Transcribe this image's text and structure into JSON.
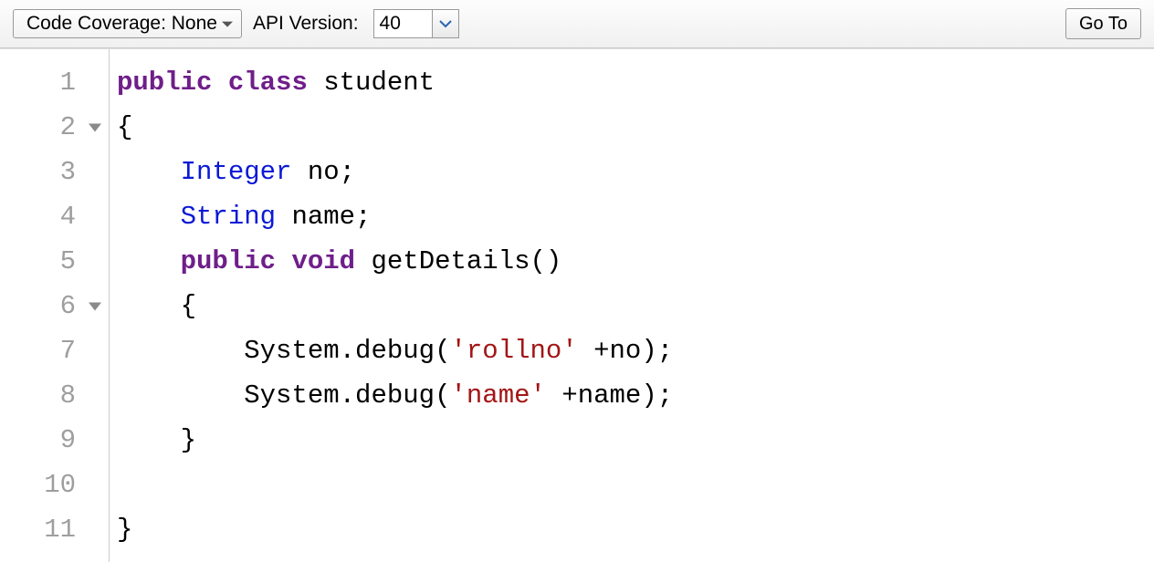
{
  "toolbar": {
    "code_coverage_label": "Code Coverage: None",
    "api_version_label": "API Version:",
    "api_version_value": "40",
    "goto_label": "Go To"
  },
  "editor": {
    "lines": [
      {
        "num": "1",
        "fold": false,
        "tokens": [
          [
            "kw",
            "public"
          ],
          [
            "plain",
            " "
          ],
          [
            "kw",
            "class"
          ],
          [
            "plain",
            " "
          ],
          [
            "ident",
            "student"
          ]
        ]
      },
      {
        "num": "2",
        "fold": true,
        "tokens": [
          [
            "punct",
            "{"
          ]
        ]
      },
      {
        "num": "3",
        "fold": false,
        "tokens": [
          [
            "plain",
            "    "
          ],
          [
            "type",
            "Integer"
          ],
          [
            "plain",
            " "
          ],
          [
            "ident",
            "no"
          ],
          [
            "punct",
            ";"
          ]
        ]
      },
      {
        "num": "4",
        "fold": false,
        "tokens": [
          [
            "plain",
            "    "
          ],
          [
            "type",
            "String"
          ],
          [
            "plain",
            " "
          ],
          [
            "ident",
            "name"
          ],
          [
            "punct",
            ";"
          ]
        ]
      },
      {
        "num": "5",
        "fold": false,
        "tokens": [
          [
            "plain",
            "    "
          ],
          [
            "kw",
            "public"
          ],
          [
            "plain",
            " "
          ],
          [
            "kw",
            "void"
          ],
          [
            "plain",
            " "
          ],
          [
            "ident",
            "getDetails"
          ],
          [
            "punct",
            "()"
          ]
        ]
      },
      {
        "num": "6",
        "fold": true,
        "tokens": [
          [
            "plain",
            "    "
          ],
          [
            "punct",
            "{"
          ]
        ]
      },
      {
        "num": "7",
        "fold": false,
        "tokens": [
          [
            "plain",
            "        "
          ],
          [
            "sysc",
            "System.debug("
          ],
          [
            "str",
            "'rollno'"
          ],
          [
            "plain",
            " "
          ],
          [
            "sysc",
            "+no);"
          ]
        ]
      },
      {
        "num": "8",
        "fold": false,
        "tokens": [
          [
            "plain",
            "        "
          ],
          [
            "sysc",
            "System.debug("
          ],
          [
            "str",
            "'name'"
          ],
          [
            "plain",
            " "
          ],
          [
            "sysc",
            "+name);"
          ]
        ]
      },
      {
        "num": "9",
        "fold": false,
        "tokens": [
          [
            "plain",
            "    "
          ],
          [
            "punct",
            "}"
          ]
        ]
      },
      {
        "num": "10",
        "fold": false,
        "tokens": []
      },
      {
        "num": "11",
        "fold": false,
        "tokens": [
          [
            "punct",
            "}"
          ]
        ]
      }
    ]
  }
}
